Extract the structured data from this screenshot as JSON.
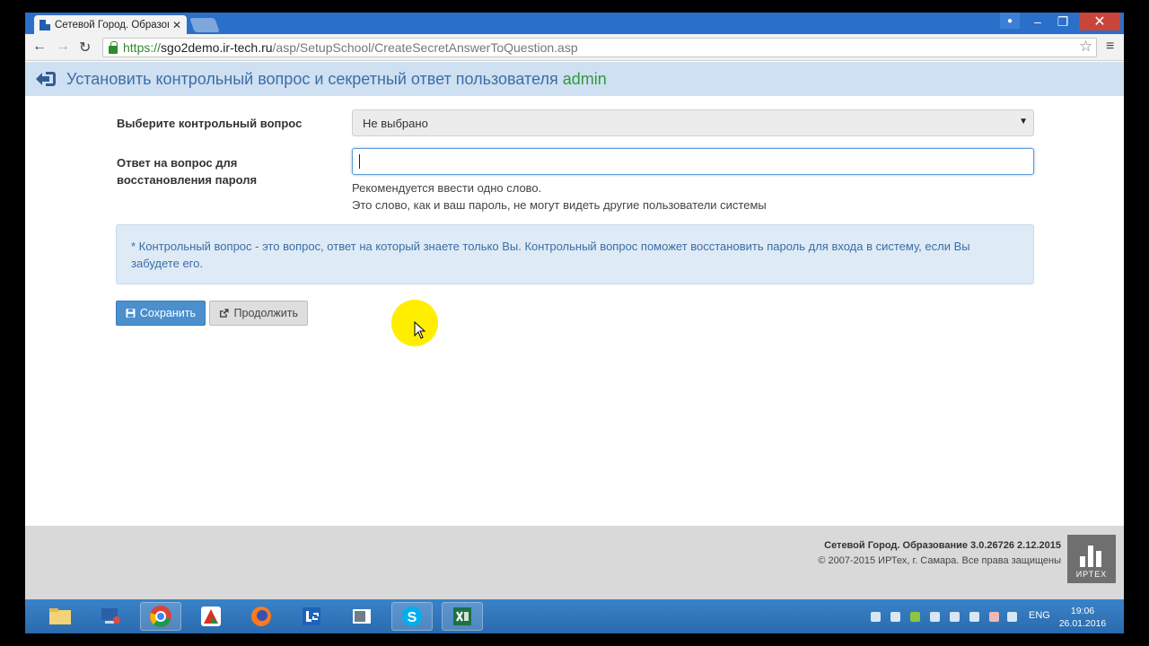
{
  "browser": {
    "tab_title": "Сетевой Город. Образова",
    "url_scheme": "https://",
    "url_host": "sgo2demo.ir-tech.ru",
    "url_path": "/asp/SetupSchool/CreateSecretAnswerToQuestion.asp"
  },
  "header": {
    "title": "Установить контрольный вопрос и секретный ответ пользователя",
    "username": "admin"
  },
  "form": {
    "question_label": "Выберите контрольный вопрос",
    "question_selected": "Не выбрано",
    "answer_label_line1": "Ответ на вопрос для",
    "answer_label_line2": "восстановления пароля",
    "answer_value": "",
    "help_line1": "Рекомендуется ввести одно слово.",
    "help_line2": "Это слово, как и ваш пароль, не могут видеть другие пользователи системы"
  },
  "info": {
    "text": "* Контрольный вопрос - это вопрос, ответ на который знаете только Вы. Контрольный вопрос поможет восстановить пароль для входа в систему, если Вы забудете его."
  },
  "buttons": {
    "save": "Сохранить",
    "continue": "Продолжить"
  },
  "footer": {
    "product": "Сетевой Город. Образование  3.0.26726  2.12.2015",
    "copyright": "© 2007-2015 ИРТех, г. Самара. Все права защищены",
    "logo_text": "ИРТЕХ"
  },
  "taskbar": {
    "language": "ENG",
    "time": "19:06",
    "date": "26.01.2016"
  },
  "colors": {
    "header_bg": "#cfe0f2",
    "header_text": "#3b6ea5",
    "username": "#2f9a3a",
    "save_button": "#4b8fcd"
  }
}
